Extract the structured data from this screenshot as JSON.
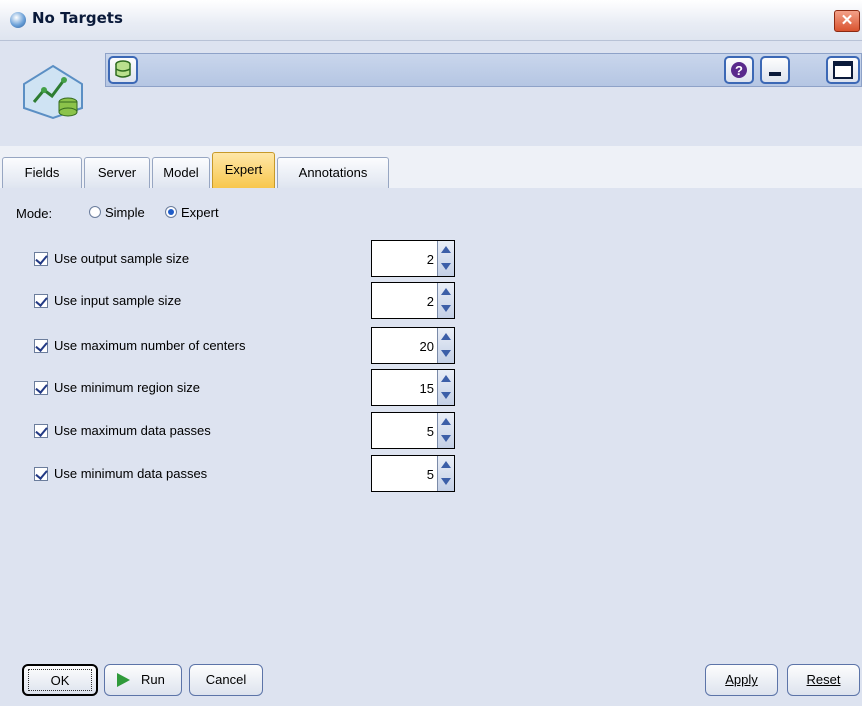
{
  "window": {
    "title": "No Targets"
  },
  "tabs": [
    {
      "label": "Fields"
    },
    {
      "label": "Server"
    },
    {
      "label": "Model"
    },
    {
      "label": "Expert"
    },
    {
      "label": "Annotations"
    }
  ],
  "active_tab": "Expert",
  "mode": {
    "label": "Mode:",
    "simple": "Simple",
    "expert": "Expert",
    "selected": "Expert"
  },
  "options": [
    {
      "label": "Use output sample size",
      "checked": true,
      "value": "2"
    },
    {
      "label": "Use input sample size",
      "checked": true,
      "value": "2"
    },
    {
      "label": "Use maximum number of centers",
      "checked": true,
      "value": "20"
    },
    {
      "label": "Use minimum region size",
      "checked": true,
      "value": "15"
    },
    {
      "label": "Use maximum data passes",
      "checked": true,
      "value": "5"
    },
    {
      "label": "Use minimum data passes",
      "checked": true,
      "value": "5"
    }
  ],
  "buttons": {
    "ok": "OK",
    "run": "Run",
    "cancel": "Cancel",
    "apply": "Apply",
    "reset": "Reset"
  },
  "icons": {
    "close": "close-icon",
    "database": "database-icon",
    "help": "help-icon",
    "minimize": "minimize-icon",
    "maximize": "maximize-icon",
    "node": "model-node-icon",
    "run": "play-icon"
  },
  "colors": {
    "active_tab": "#f7c64a",
    "run_icon": "#2f9a3a",
    "window_bg": "#dde3f0"
  }
}
